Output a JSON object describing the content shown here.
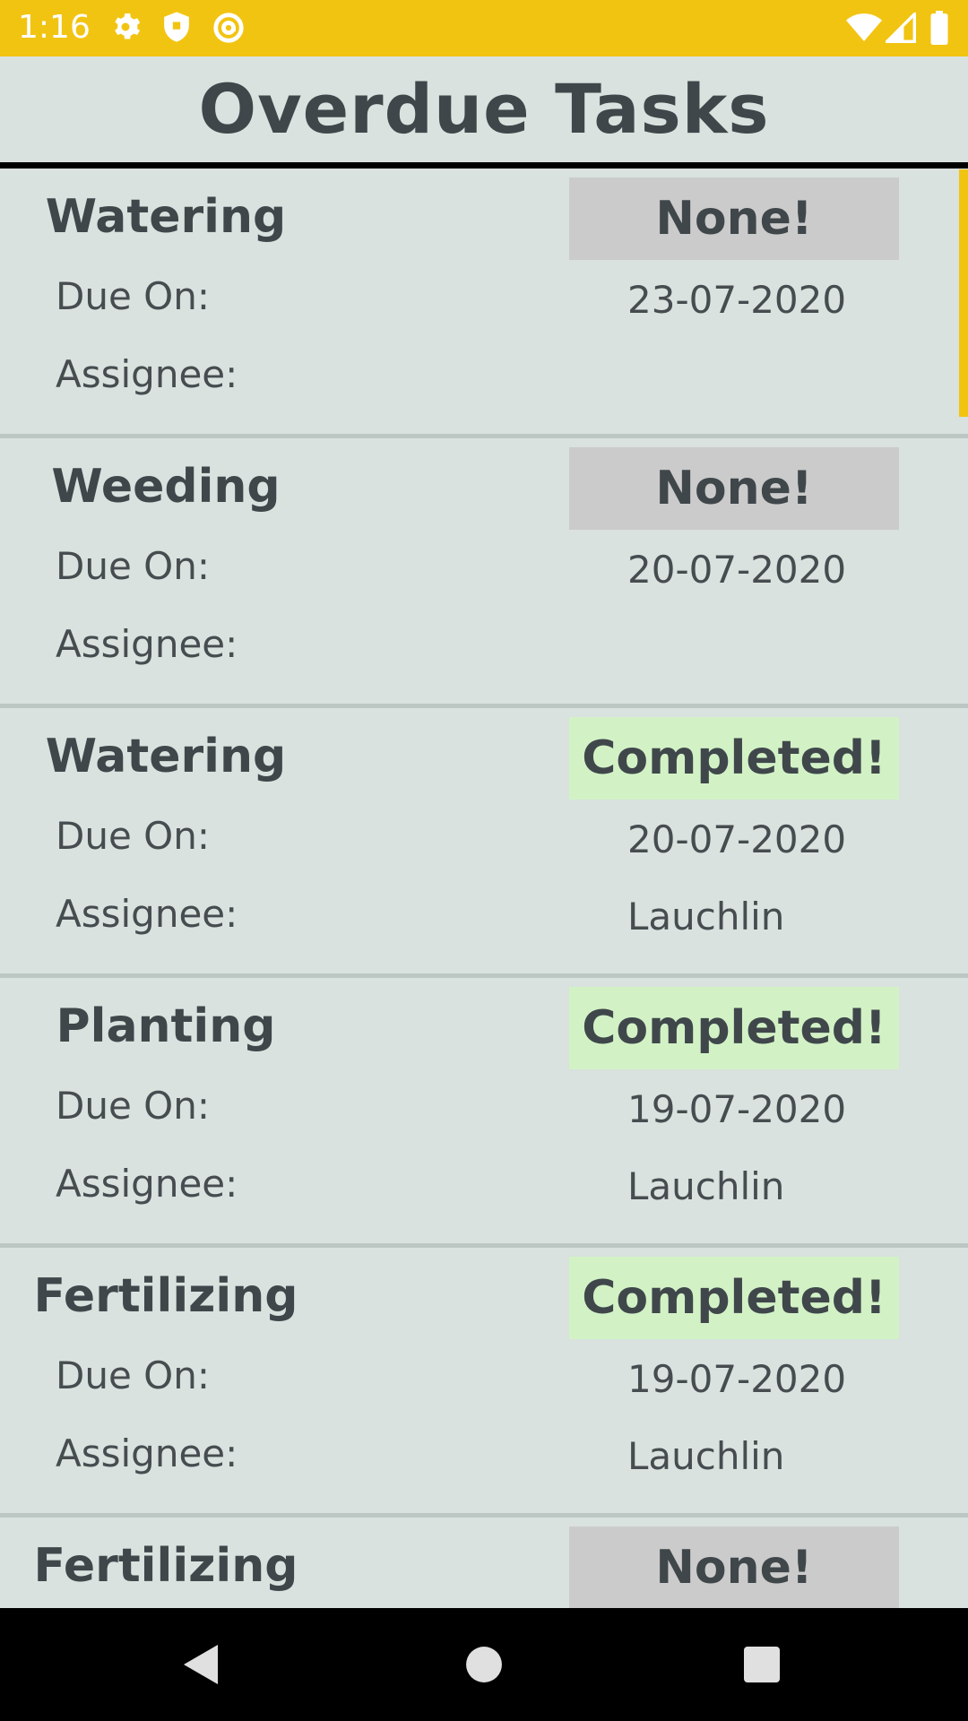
{
  "status_bar": {
    "time": "1:16",
    "icons": [
      "gear-icon",
      "shield-icon",
      "at-sign-icon",
      "wifi-icon",
      "signal-icon",
      "battery-icon"
    ]
  },
  "header": {
    "title": "Overdue Tasks"
  },
  "labels": {
    "due_on": "Due On:",
    "assignee": "Assignee:"
  },
  "tasks": [
    {
      "name": "Watering",
      "status": "None!",
      "due_date": "23-07-2020",
      "assignee": ""
    },
    {
      "name": "Weeding",
      "status": "None!",
      "due_date": "20-07-2020",
      "assignee": ""
    },
    {
      "name": "Watering",
      "status": "Completed!",
      "due_date": "20-07-2020",
      "assignee": "Lauchlin"
    },
    {
      "name": "Planting",
      "status": "Completed!",
      "due_date": "19-07-2020",
      "assignee": "Lauchlin"
    },
    {
      "name": "Fertilizing",
      "status": "Completed!",
      "due_date": "19-07-2020",
      "assignee": "Lauchlin"
    },
    {
      "name": "Fertilizing",
      "status": "None!",
      "due_date": "",
      "assignee": ""
    }
  ],
  "colors": {
    "accent": "#f2c412",
    "background": "#d9e2de",
    "status_none": "#cbcbcb",
    "status_completed": "#d2f2c6"
  },
  "nav_bar": {
    "buttons": [
      "back-icon",
      "home-icon",
      "recents-icon"
    ]
  }
}
